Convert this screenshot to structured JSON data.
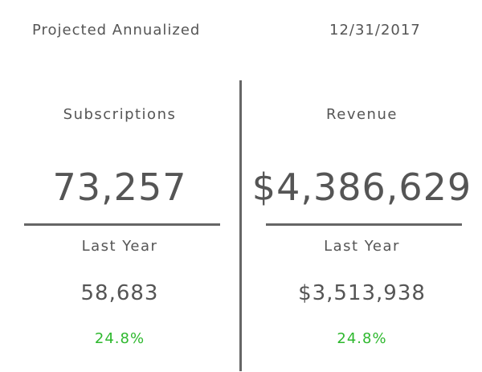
{
  "header": {
    "title": "Projected Annualized",
    "date": "12/31/2017"
  },
  "subscriptions": {
    "label": "Subscriptions",
    "value": "73,257",
    "last_year_label": "Last Year",
    "last_year_value": "58,683",
    "change": "24.8%"
  },
  "revenue": {
    "label": "Revenue",
    "value": "$4,386,629",
    "last_year_label": "Last Year",
    "last_year_value": "$3,513,938",
    "change": "24.8%"
  },
  "colors": {
    "text": "#555555",
    "rule": "#666666",
    "positive_change": "#2eb82e"
  }
}
